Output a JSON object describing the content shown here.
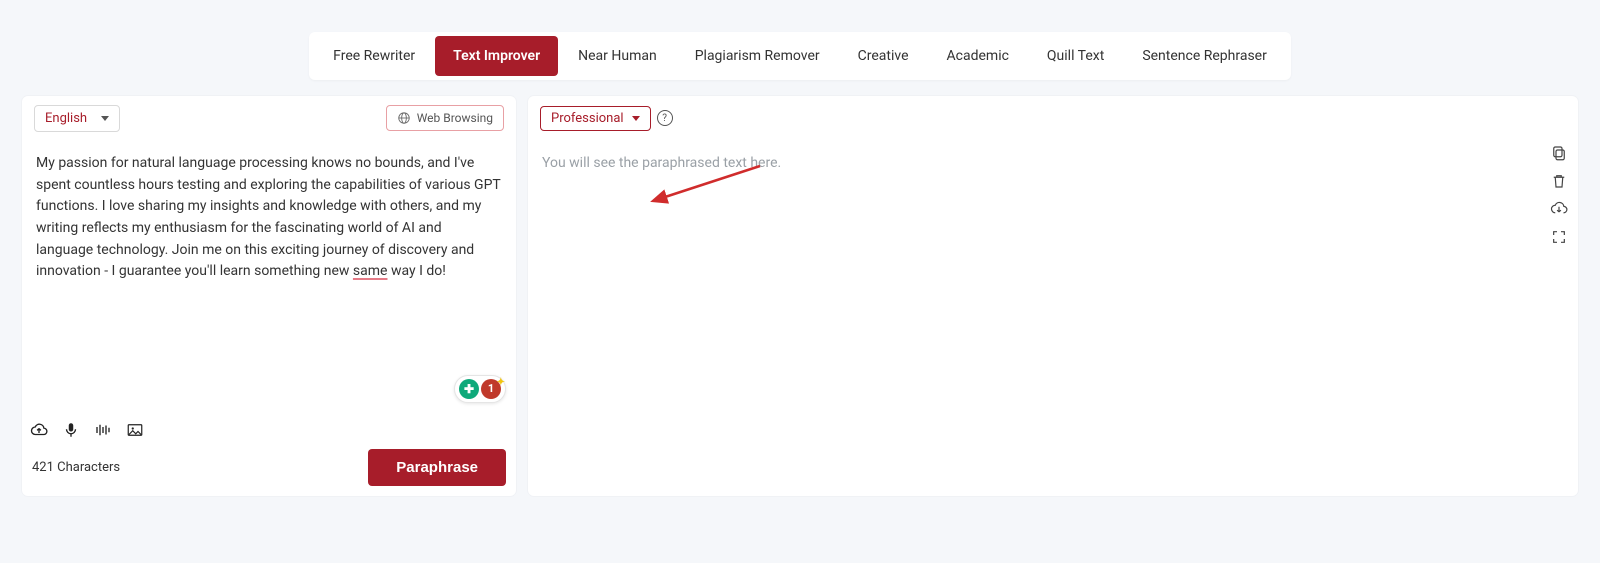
{
  "tabs": [
    {
      "label": "Free Rewriter",
      "active": false
    },
    {
      "label": "Text Improver",
      "active": true
    },
    {
      "label": "Near Human",
      "active": false
    },
    {
      "label": "Plagiarism Remover",
      "active": false
    },
    {
      "label": "Creative",
      "active": false
    },
    {
      "label": "Academic",
      "active": false
    },
    {
      "label": "Quill Text",
      "active": false
    },
    {
      "label": "Sentence Rephraser",
      "active": false
    }
  ],
  "left": {
    "language": "English",
    "web_browsing_label": "Web Browsing",
    "text_prefix": "My passion for natural language processing knows no bounds, and I've spent countless hours testing and exploring the capabilities of various GPT functions. I love sharing my insights and knowledge with others, and my writing reflects my enthusiasm for the fascinating world of AI and language technology. Join me on this exciting journey of discovery and innovation - I guarantee you'll learn something new ",
    "text_highlight": "same",
    "text_suffix": " way I do!",
    "char_count_label": "421 Characters",
    "paraphrase_label": "Paraphrase",
    "badge_grammar_glyph": "✚",
    "badge_error_count": "1"
  },
  "right": {
    "tone_selected": "Professional",
    "placeholder": "You will see the paraphrased text here."
  },
  "colors": {
    "primary": "#a71d2a",
    "page_bg": "#f5f7fa"
  }
}
